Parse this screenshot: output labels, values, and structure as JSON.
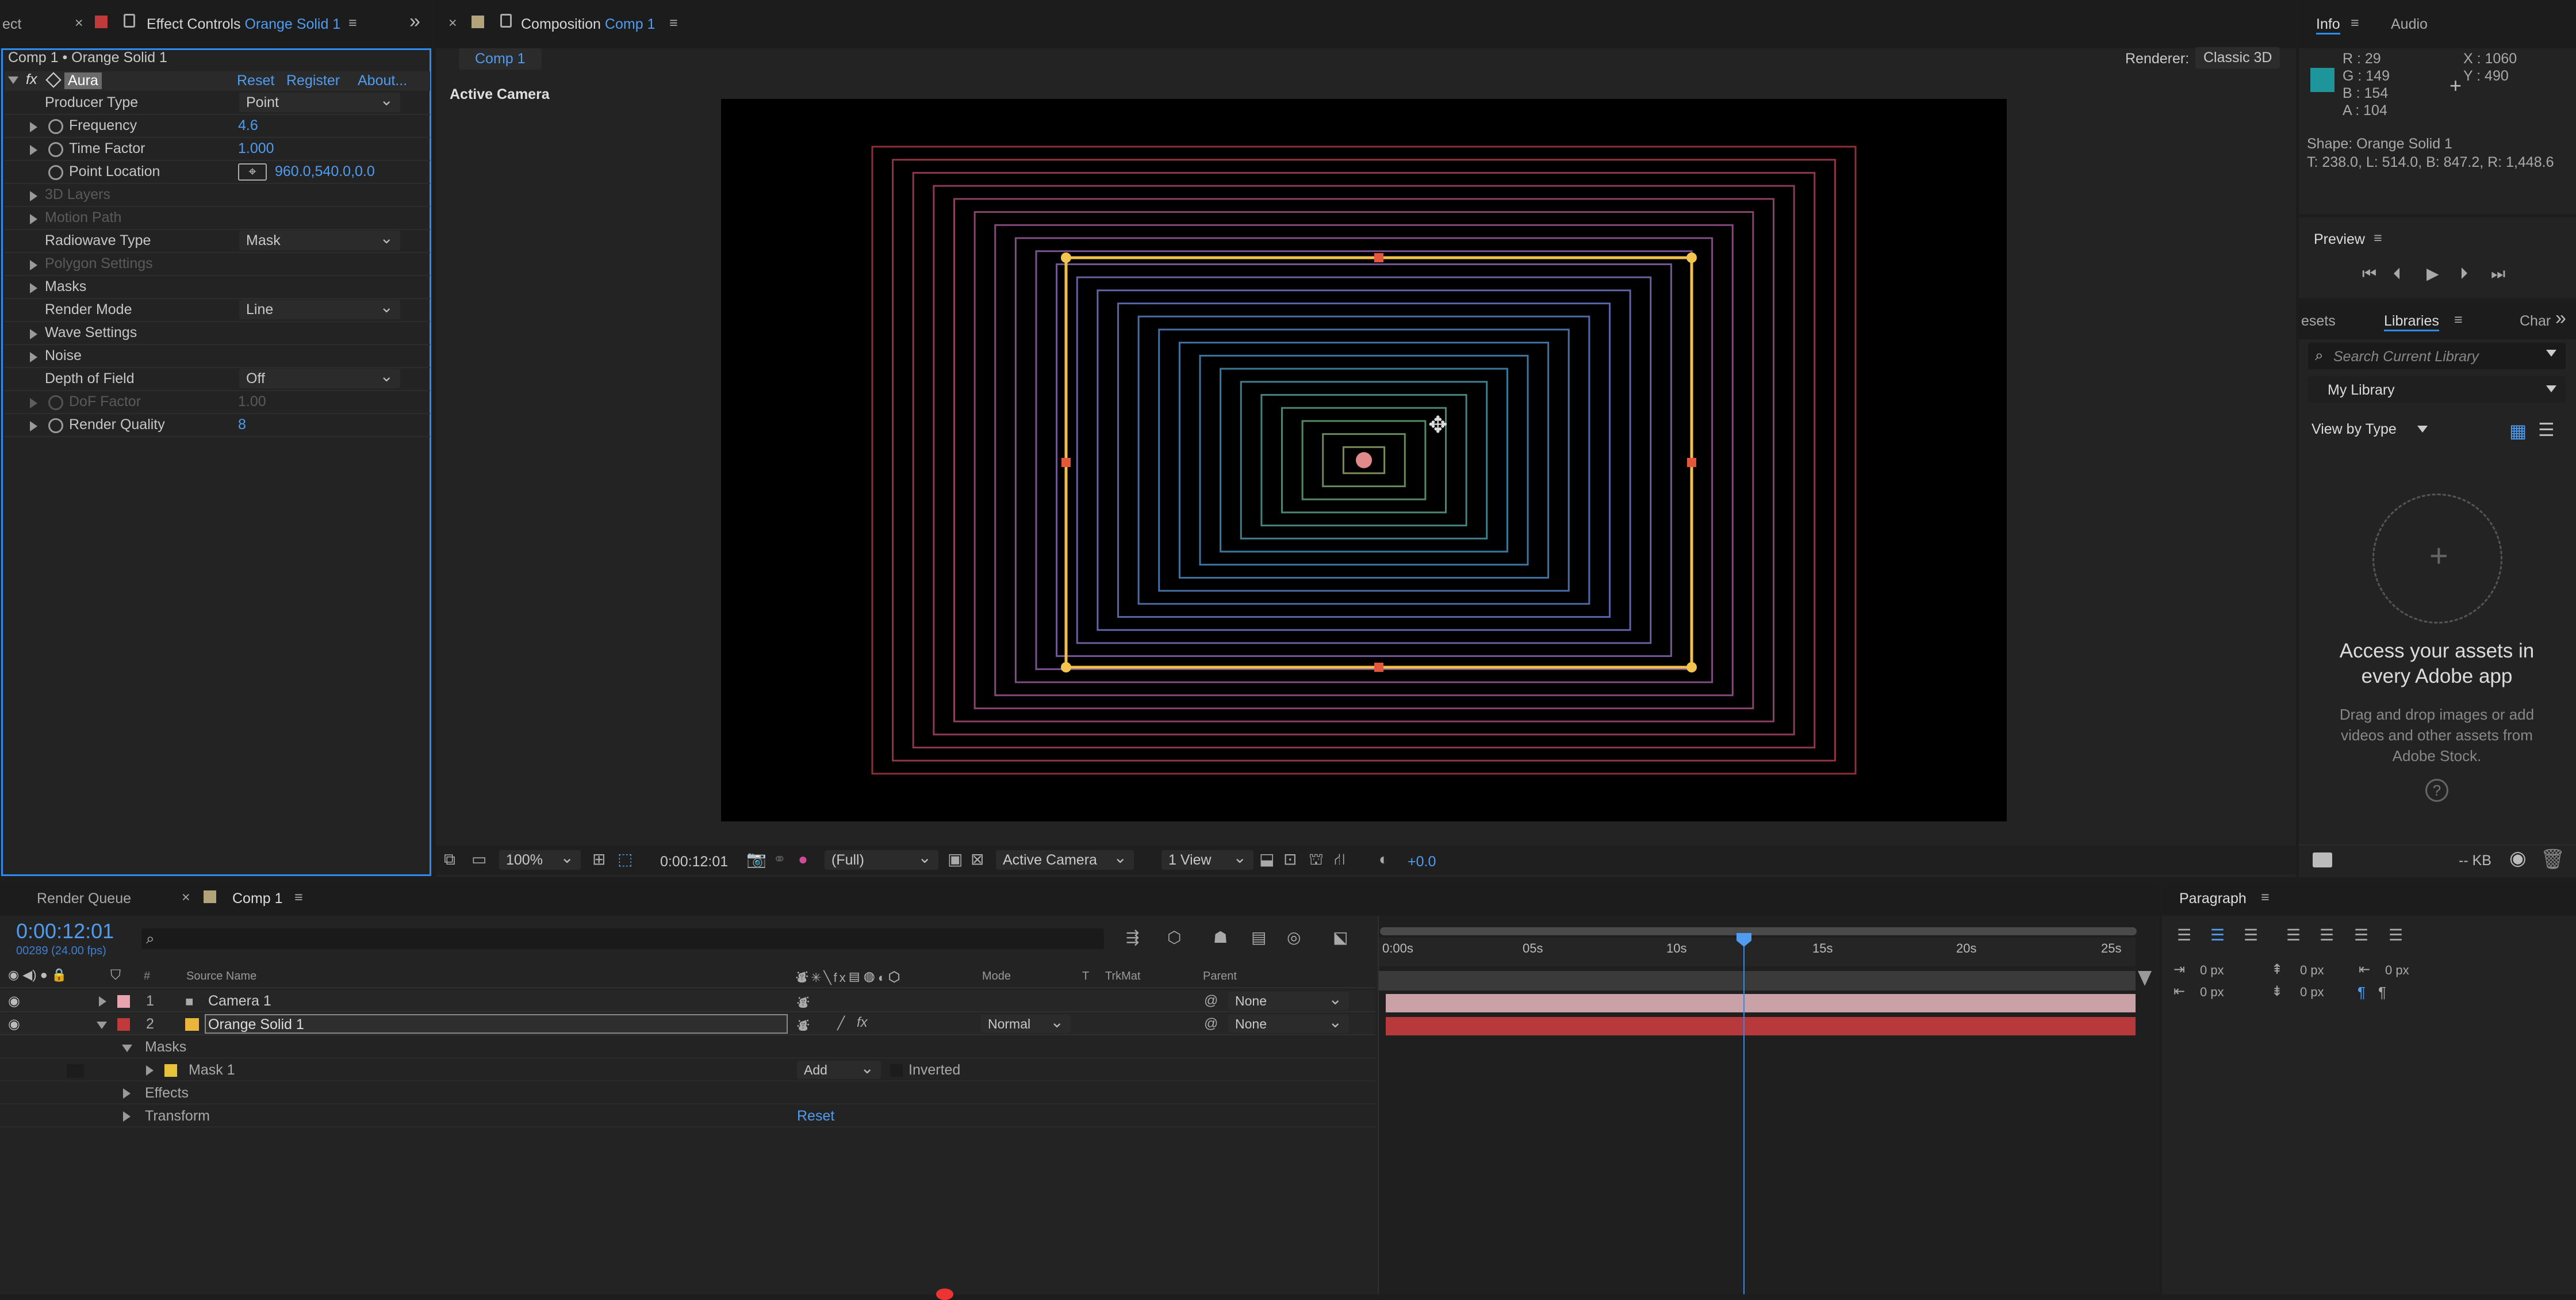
{
  "effect_panel": {
    "tab_partial": "ect",
    "tab_prefix": "Effect Controls ",
    "tab_layer": "Orange Solid 1",
    "layer_path": "Comp 1 • Orange Solid 1",
    "effect_name": "Aura",
    "reset": "Reset",
    "register": "Register",
    "about": "About...",
    "props": [
      {
        "label": "Producer Type",
        "value": "Point"
      },
      {
        "label": "Frequency",
        "value": "4.6"
      },
      {
        "label": "Time Factor",
        "value": "1.000"
      },
      {
        "label": "Point Location",
        "value": "960.0,540.0,0.0"
      },
      {
        "label": "3D Layers"
      },
      {
        "label": "Motion Path"
      },
      {
        "label": "Radiowave Type",
        "value": "Mask"
      },
      {
        "label": "Polygon Settings"
      },
      {
        "label": "Masks"
      },
      {
        "label": "Render Mode",
        "value": "Line"
      },
      {
        "label": "Wave Settings"
      },
      {
        "label": "Noise"
      },
      {
        "label": "Depth of Field",
        "value": "Off"
      },
      {
        "label": "DoF Factor",
        "value": "1.00"
      },
      {
        "label": "Render Quality",
        "value": "8"
      }
    ]
  },
  "comp_panel": {
    "tab_prefix": "Composition ",
    "tab_comp": "Comp 1",
    "sub_tab": "Comp 1",
    "renderer_label": "Renderer:",
    "renderer_value": "Classic 3D",
    "active_camera": "Active Camera",
    "zoom": "100%",
    "timecode": "0:00:12:01",
    "resolution": "(Full)",
    "view": "Active Camera",
    "views": "1 View",
    "exposure": "+0.0"
  },
  "info": {
    "tab_info": "Info",
    "tab_audio": "Audio",
    "r": "R : 29",
    "g": "G : 149",
    "b": "B : 154",
    "a": "A : 104",
    "x": "X : 1060",
    "y": "Y : 490",
    "shape": "Shape: Orange Solid 1",
    "bounds": "T: 238.0, L: 514.0, B: 847.2, R: 1,448.6",
    "swatch": "#1d959a"
  },
  "preview": {
    "title": "Preview"
  },
  "libraries": {
    "tab_left": "esets",
    "tab": "Libraries",
    "tab_right": "Char",
    "search": "Search Current Library",
    "library": "My Library",
    "view_by": "View by Type",
    "headline": "Access your assets in every Adobe app",
    "sub": "Drag and drop images or add videos and other assets from Adobe Stock.",
    "size": "-- KB"
  },
  "timeline": {
    "tab_render": "Render Queue",
    "tab_comp": "Comp 1",
    "timecode": "0:00:12:01",
    "frames": "00289 (24.00 fps)",
    "col_num": "#",
    "col_source": "Source Name",
    "col_mode": "Mode",
    "col_t": "T",
    "col_trkmat": "TrkMat",
    "col_parent": "Parent",
    "ruler": [
      "0:00s",
      "05s",
      "10s",
      "15s",
      "20s",
      "25s"
    ],
    "layers": [
      {
        "num": "1",
        "name": "Camera 1",
        "parent": "None"
      },
      {
        "num": "2",
        "name": "Orange Solid 1",
        "mode": "Normal",
        "parent": "None"
      }
    ],
    "masks": "Masks",
    "mask1": "Mask 1",
    "mask_mode": "Add",
    "inverted": "Inverted",
    "effects": "Effects",
    "transform": "Transform",
    "transform_reset": "Reset",
    "playhead_fraction": 0.482
  },
  "paragraph": {
    "title": "Paragraph",
    "px": [
      "0 px",
      "0 px",
      "0 px",
      "0 px",
      "0 px"
    ]
  }
}
